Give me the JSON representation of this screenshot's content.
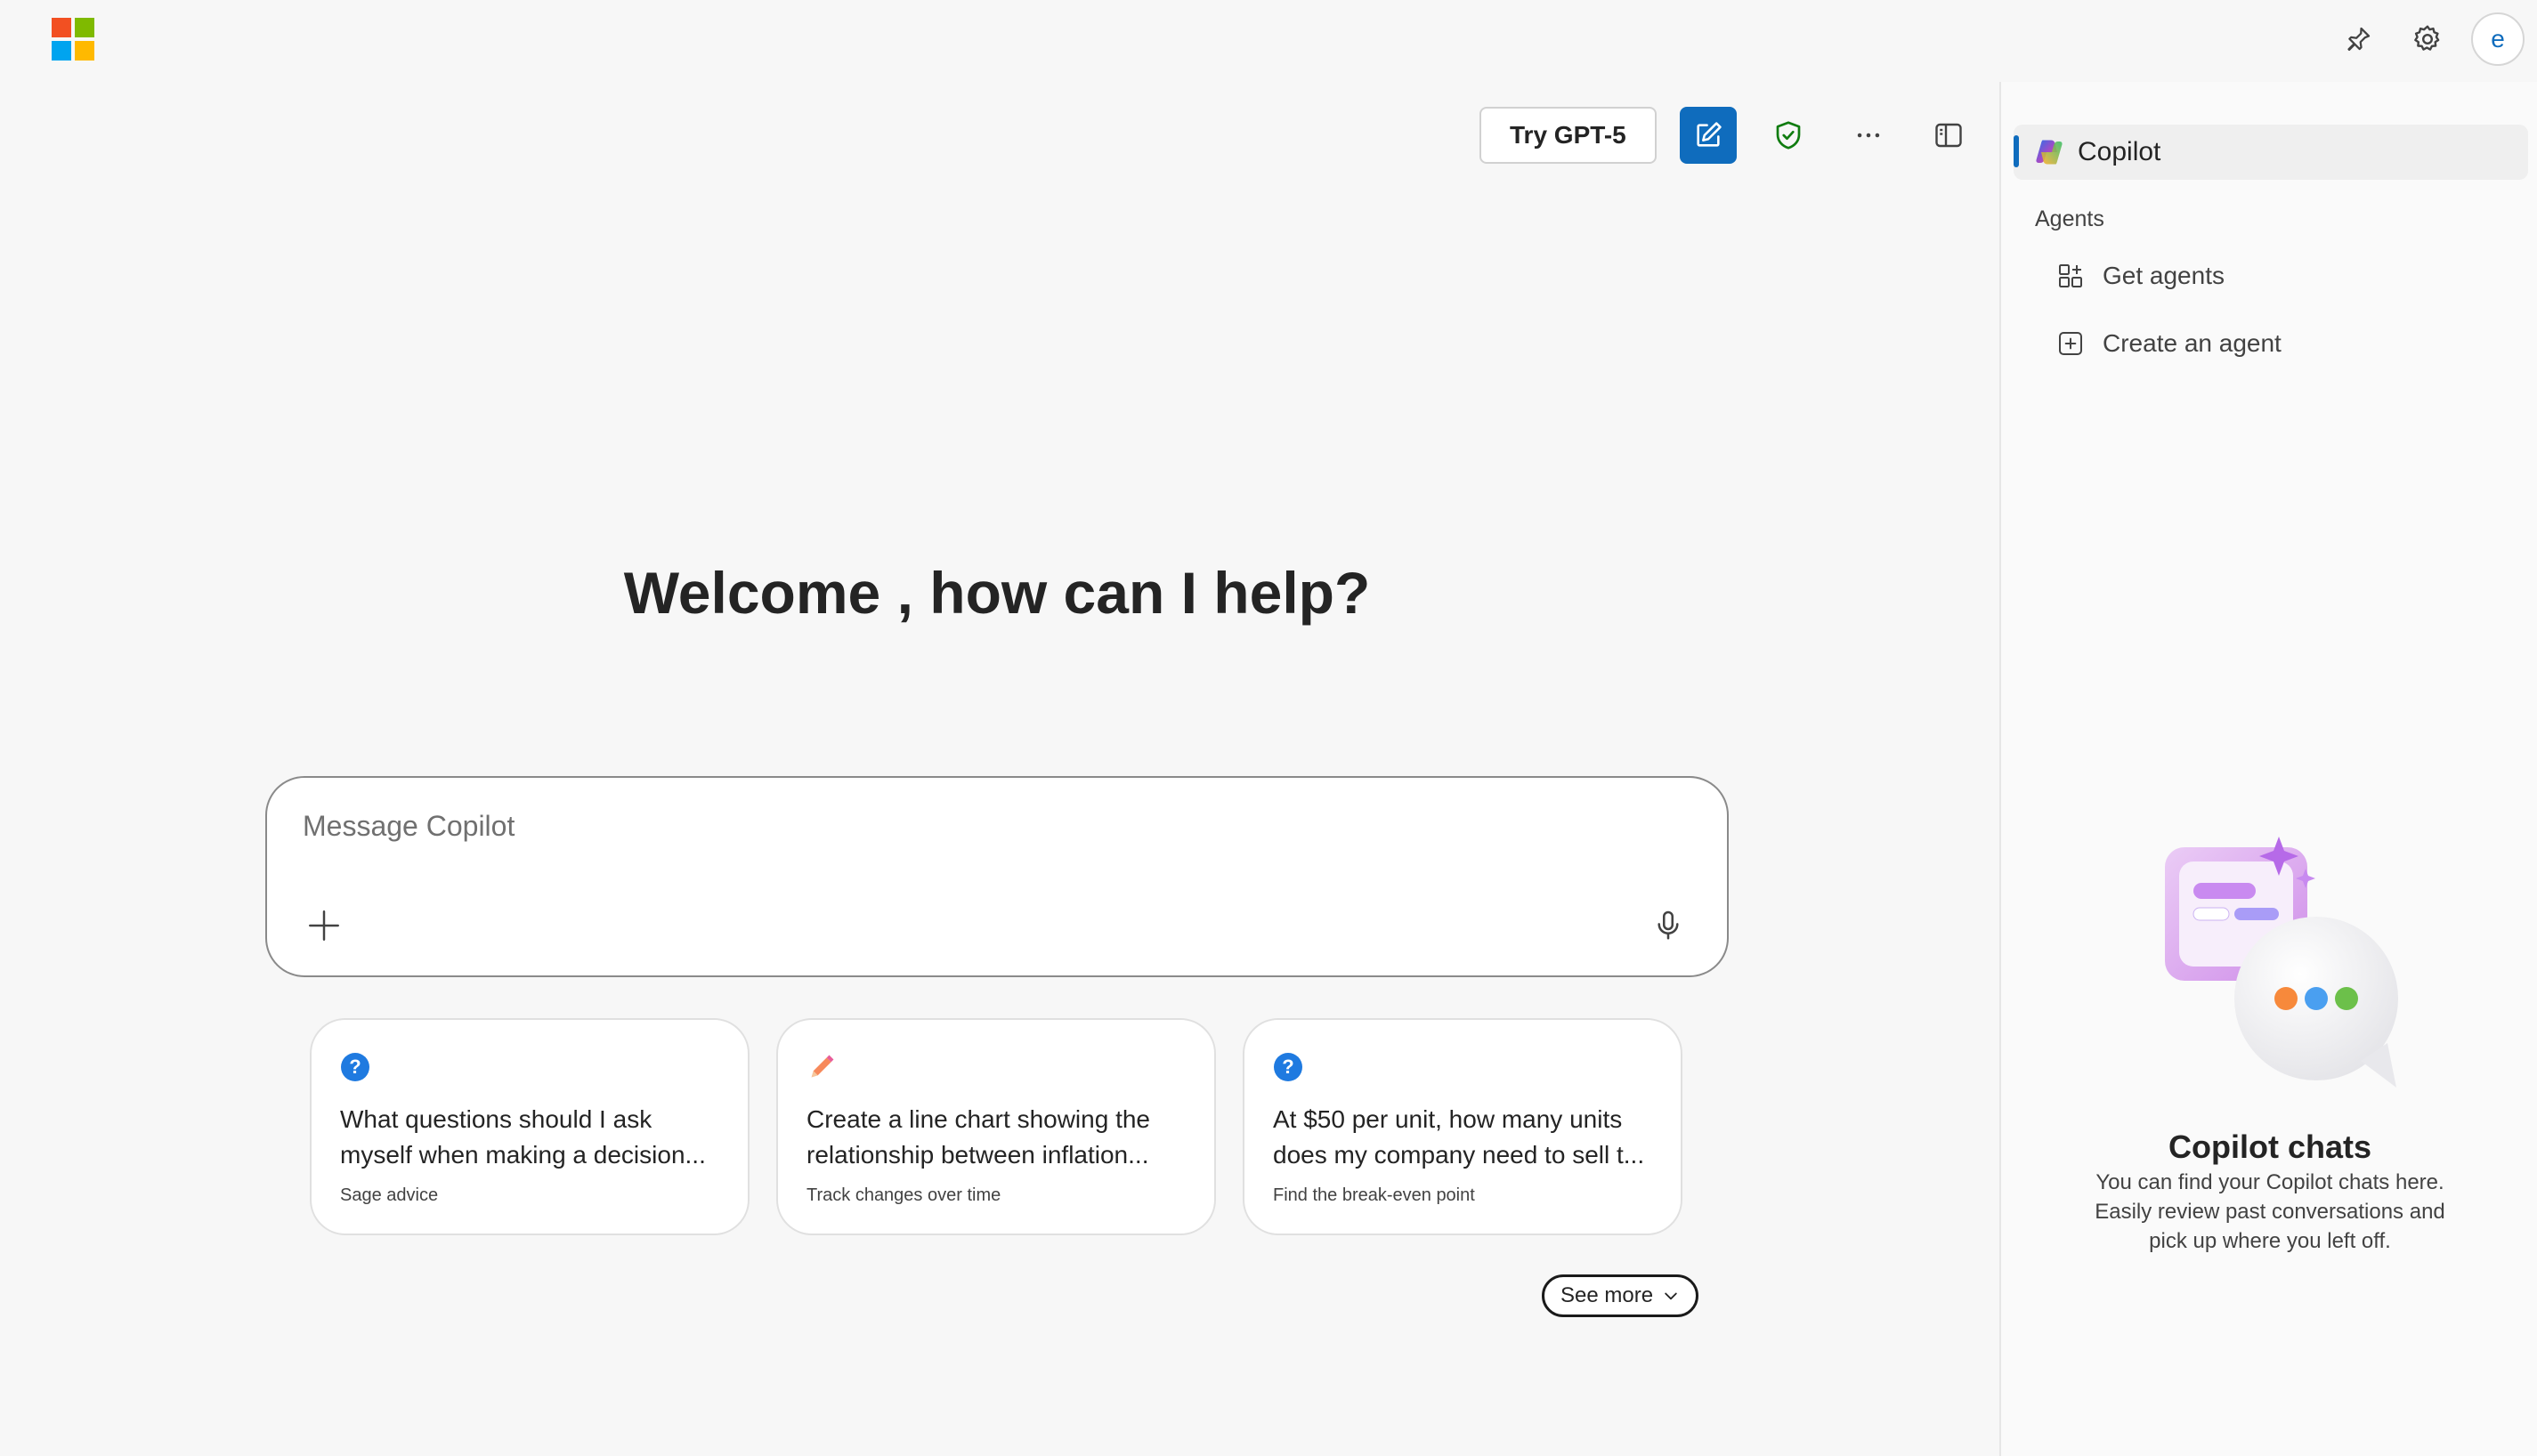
{
  "header": {
    "brand_colors": [
      "#f25022",
      "#7fba00",
      "#00a4ef",
      "#ffb900"
    ],
    "avatar_initial": "e"
  },
  "toolbar": {
    "try_label": "Try GPT-5",
    "accent": "#0f6cbd"
  },
  "main": {
    "welcome": "Welcome , how can I help?",
    "composer_placeholder": "Message Copilot",
    "cards": [
      {
        "icon": "question-icon",
        "title": "What questions should I ask myself when making a decision...",
        "subtitle": "Sage advice"
      },
      {
        "icon": "pencil-icon",
        "title": "Create a line chart showing the relationship between inflation...",
        "subtitle": "Track changes over time"
      },
      {
        "icon": "question-icon",
        "title": "At $50 per unit, how many units does my company need to sell t...",
        "subtitle": "Find the break-even point"
      }
    ],
    "see_more": "See more"
  },
  "panel": {
    "copilot_label": "Copilot",
    "agents_heading": "Agents",
    "get_agents": "Get agents",
    "create_agent": "Create an agent",
    "chats_title": "Copilot chats",
    "chats_desc": "You can find your Copilot chats here. Easily review past conversations and pick up where you left off."
  }
}
